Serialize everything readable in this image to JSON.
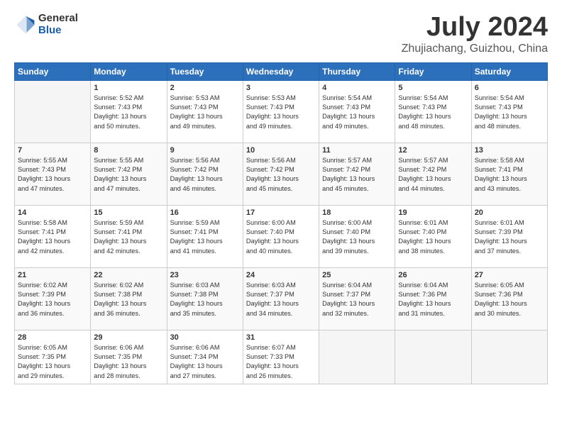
{
  "header": {
    "logo_general": "General",
    "logo_blue": "Blue",
    "title": "July 2024",
    "subtitle": "Zhujiachang, Guizhou, China"
  },
  "days_of_week": [
    "Sunday",
    "Monday",
    "Tuesday",
    "Wednesday",
    "Thursday",
    "Friday",
    "Saturday"
  ],
  "weeks": [
    [
      {
        "day": "",
        "info": ""
      },
      {
        "day": "1",
        "info": "Sunrise: 5:52 AM\nSunset: 7:43 PM\nDaylight: 13 hours\nand 50 minutes."
      },
      {
        "day": "2",
        "info": "Sunrise: 5:53 AM\nSunset: 7:43 PM\nDaylight: 13 hours\nand 49 minutes."
      },
      {
        "day": "3",
        "info": "Sunrise: 5:53 AM\nSunset: 7:43 PM\nDaylight: 13 hours\nand 49 minutes."
      },
      {
        "day": "4",
        "info": "Sunrise: 5:54 AM\nSunset: 7:43 PM\nDaylight: 13 hours\nand 49 minutes."
      },
      {
        "day": "5",
        "info": "Sunrise: 5:54 AM\nSunset: 7:43 PM\nDaylight: 13 hours\nand 48 minutes."
      },
      {
        "day": "6",
        "info": "Sunrise: 5:54 AM\nSunset: 7:43 PM\nDaylight: 13 hours\nand 48 minutes."
      }
    ],
    [
      {
        "day": "7",
        "info": "Sunrise: 5:55 AM\nSunset: 7:43 PM\nDaylight: 13 hours\nand 47 minutes."
      },
      {
        "day": "8",
        "info": "Sunrise: 5:55 AM\nSunset: 7:42 PM\nDaylight: 13 hours\nand 47 minutes."
      },
      {
        "day": "9",
        "info": "Sunrise: 5:56 AM\nSunset: 7:42 PM\nDaylight: 13 hours\nand 46 minutes."
      },
      {
        "day": "10",
        "info": "Sunrise: 5:56 AM\nSunset: 7:42 PM\nDaylight: 13 hours\nand 45 minutes."
      },
      {
        "day": "11",
        "info": "Sunrise: 5:57 AM\nSunset: 7:42 PM\nDaylight: 13 hours\nand 45 minutes."
      },
      {
        "day": "12",
        "info": "Sunrise: 5:57 AM\nSunset: 7:42 PM\nDaylight: 13 hours\nand 44 minutes."
      },
      {
        "day": "13",
        "info": "Sunrise: 5:58 AM\nSunset: 7:41 PM\nDaylight: 13 hours\nand 43 minutes."
      }
    ],
    [
      {
        "day": "14",
        "info": "Sunrise: 5:58 AM\nSunset: 7:41 PM\nDaylight: 13 hours\nand 42 minutes."
      },
      {
        "day": "15",
        "info": "Sunrise: 5:59 AM\nSunset: 7:41 PM\nDaylight: 13 hours\nand 42 minutes."
      },
      {
        "day": "16",
        "info": "Sunrise: 5:59 AM\nSunset: 7:41 PM\nDaylight: 13 hours\nand 41 minutes."
      },
      {
        "day": "17",
        "info": "Sunrise: 6:00 AM\nSunset: 7:40 PM\nDaylight: 13 hours\nand 40 minutes."
      },
      {
        "day": "18",
        "info": "Sunrise: 6:00 AM\nSunset: 7:40 PM\nDaylight: 13 hours\nand 39 minutes."
      },
      {
        "day": "19",
        "info": "Sunrise: 6:01 AM\nSunset: 7:40 PM\nDaylight: 13 hours\nand 38 minutes."
      },
      {
        "day": "20",
        "info": "Sunrise: 6:01 AM\nSunset: 7:39 PM\nDaylight: 13 hours\nand 37 minutes."
      }
    ],
    [
      {
        "day": "21",
        "info": "Sunrise: 6:02 AM\nSunset: 7:39 PM\nDaylight: 13 hours\nand 36 minutes."
      },
      {
        "day": "22",
        "info": "Sunrise: 6:02 AM\nSunset: 7:38 PM\nDaylight: 13 hours\nand 36 minutes."
      },
      {
        "day": "23",
        "info": "Sunrise: 6:03 AM\nSunset: 7:38 PM\nDaylight: 13 hours\nand 35 minutes."
      },
      {
        "day": "24",
        "info": "Sunrise: 6:03 AM\nSunset: 7:37 PM\nDaylight: 13 hours\nand 34 minutes."
      },
      {
        "day": "25",
        "info": "Sunrise: 6:04 AM\nSunset: 7:37 PM\nDaylight: 13 hours\nand 32 minutes."
      },
      {
        "day": "26",
        "info": "Sunrise: 6:04 AM\nSunset: 7:36 PM\nDaylight: 13 hours\nand 31 minutes."
      },
      {
        "day": "27",
        "info": "Sunrise: 6:05 AM\nSunset: 7:36 PM\nDaylight: 13 hours\nand 30 minutes."
      }
    ],
    [
      {
        "day": "28",
        "info": "Sunrise: 6:05 AM\nSunset: 7:35 PM\nDaylight: 13 hours\nand 29 minutes."
      },
      {
        "day": "29",
        "info": "Sunrise: 6:06 AM\nSunset: 7:35 PM\nDaylight: 13 hours\nand 28 minutes."
      },
      {
        "day": "30",
        "info": "Sunrise: 6:06 AM\nSunset: 7:34 PM\nDaylight: 13 hours\nand 27 minutes."
      },
      {
        "day": "31",
        "info": "Sunrise: 6:07 AM\nSunset: 7:33 PM\nDaylight: 13 hours\nand 26 minutes."
      },
      {
        "day": "",
        "info": ""
      },
      {
        "day": "",
        "info": ""
      },
      {
        "day": "",
        "info": ""
      }
    ]
  ]
}
